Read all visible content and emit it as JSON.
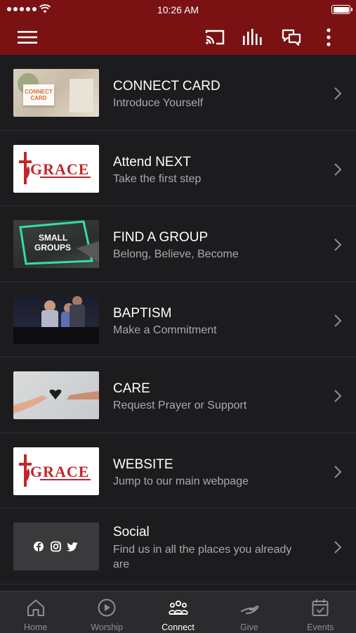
{
  "status_bar": {
    "time": "10:26 AM"
  },
  "header": {
    "icons": [
      "menu-icon",
      "cast-icon",
      "bars-icon",
      "chat-icon",
      "more-vertical-icon"
    ]
  },
  "items": [
    {
      "title": "CONNECT CARD",
      "subtitle": "Introduce Yourself",
      "thumb_text": "CONNECT CARD"
    },
    {
      "title": "Attend NEXT",
      "subtitle": "Take the first step",
      "thumb_text": "GRACE"
    },
    {
      "title": "FIND A GROUP",
      "subtitle": "Belong, Believe, Become",
      "thumb_text_1": "SMALL",
      "thumb_text_2": "GROUPS"
    },
    {
      "title": "BAPTISM",
      "subtitle": "Make a Commitment"
    },
    {
      "title": "CARE",
      "subtitle": "Request Prayer or Support"
    },
    {
      "title": "WEBSITE",
      "subtitle": "Jump to our main webpage",
      "thumb_text": "GRACE"
    },
    {
      "title": "Social",
      "subtitle": "Find us in all the places you already are"
    }
  ],
  "tabs": [
    {
      "label": "Home",
      "icon": "home-icon"
    },
    {
      "label": "Worship",
      "icon": "play-circle-icon"
    },
    {
      "label": "Connect",
      "icon": "people-icon",
      "active": true
    },
    {
      "label": "Give",
      "icon": "give-hand-icon"
    },
    {
      "label": "Events",
      "icon": "calendar-icon"
    }
  ],
  "colors": {
    "brand": "#7a1213",
    "background": "#1c1c1e",
    "tab_bar": "#2b2b2e",
    "grace_red": "#c1272d"
  }
}
